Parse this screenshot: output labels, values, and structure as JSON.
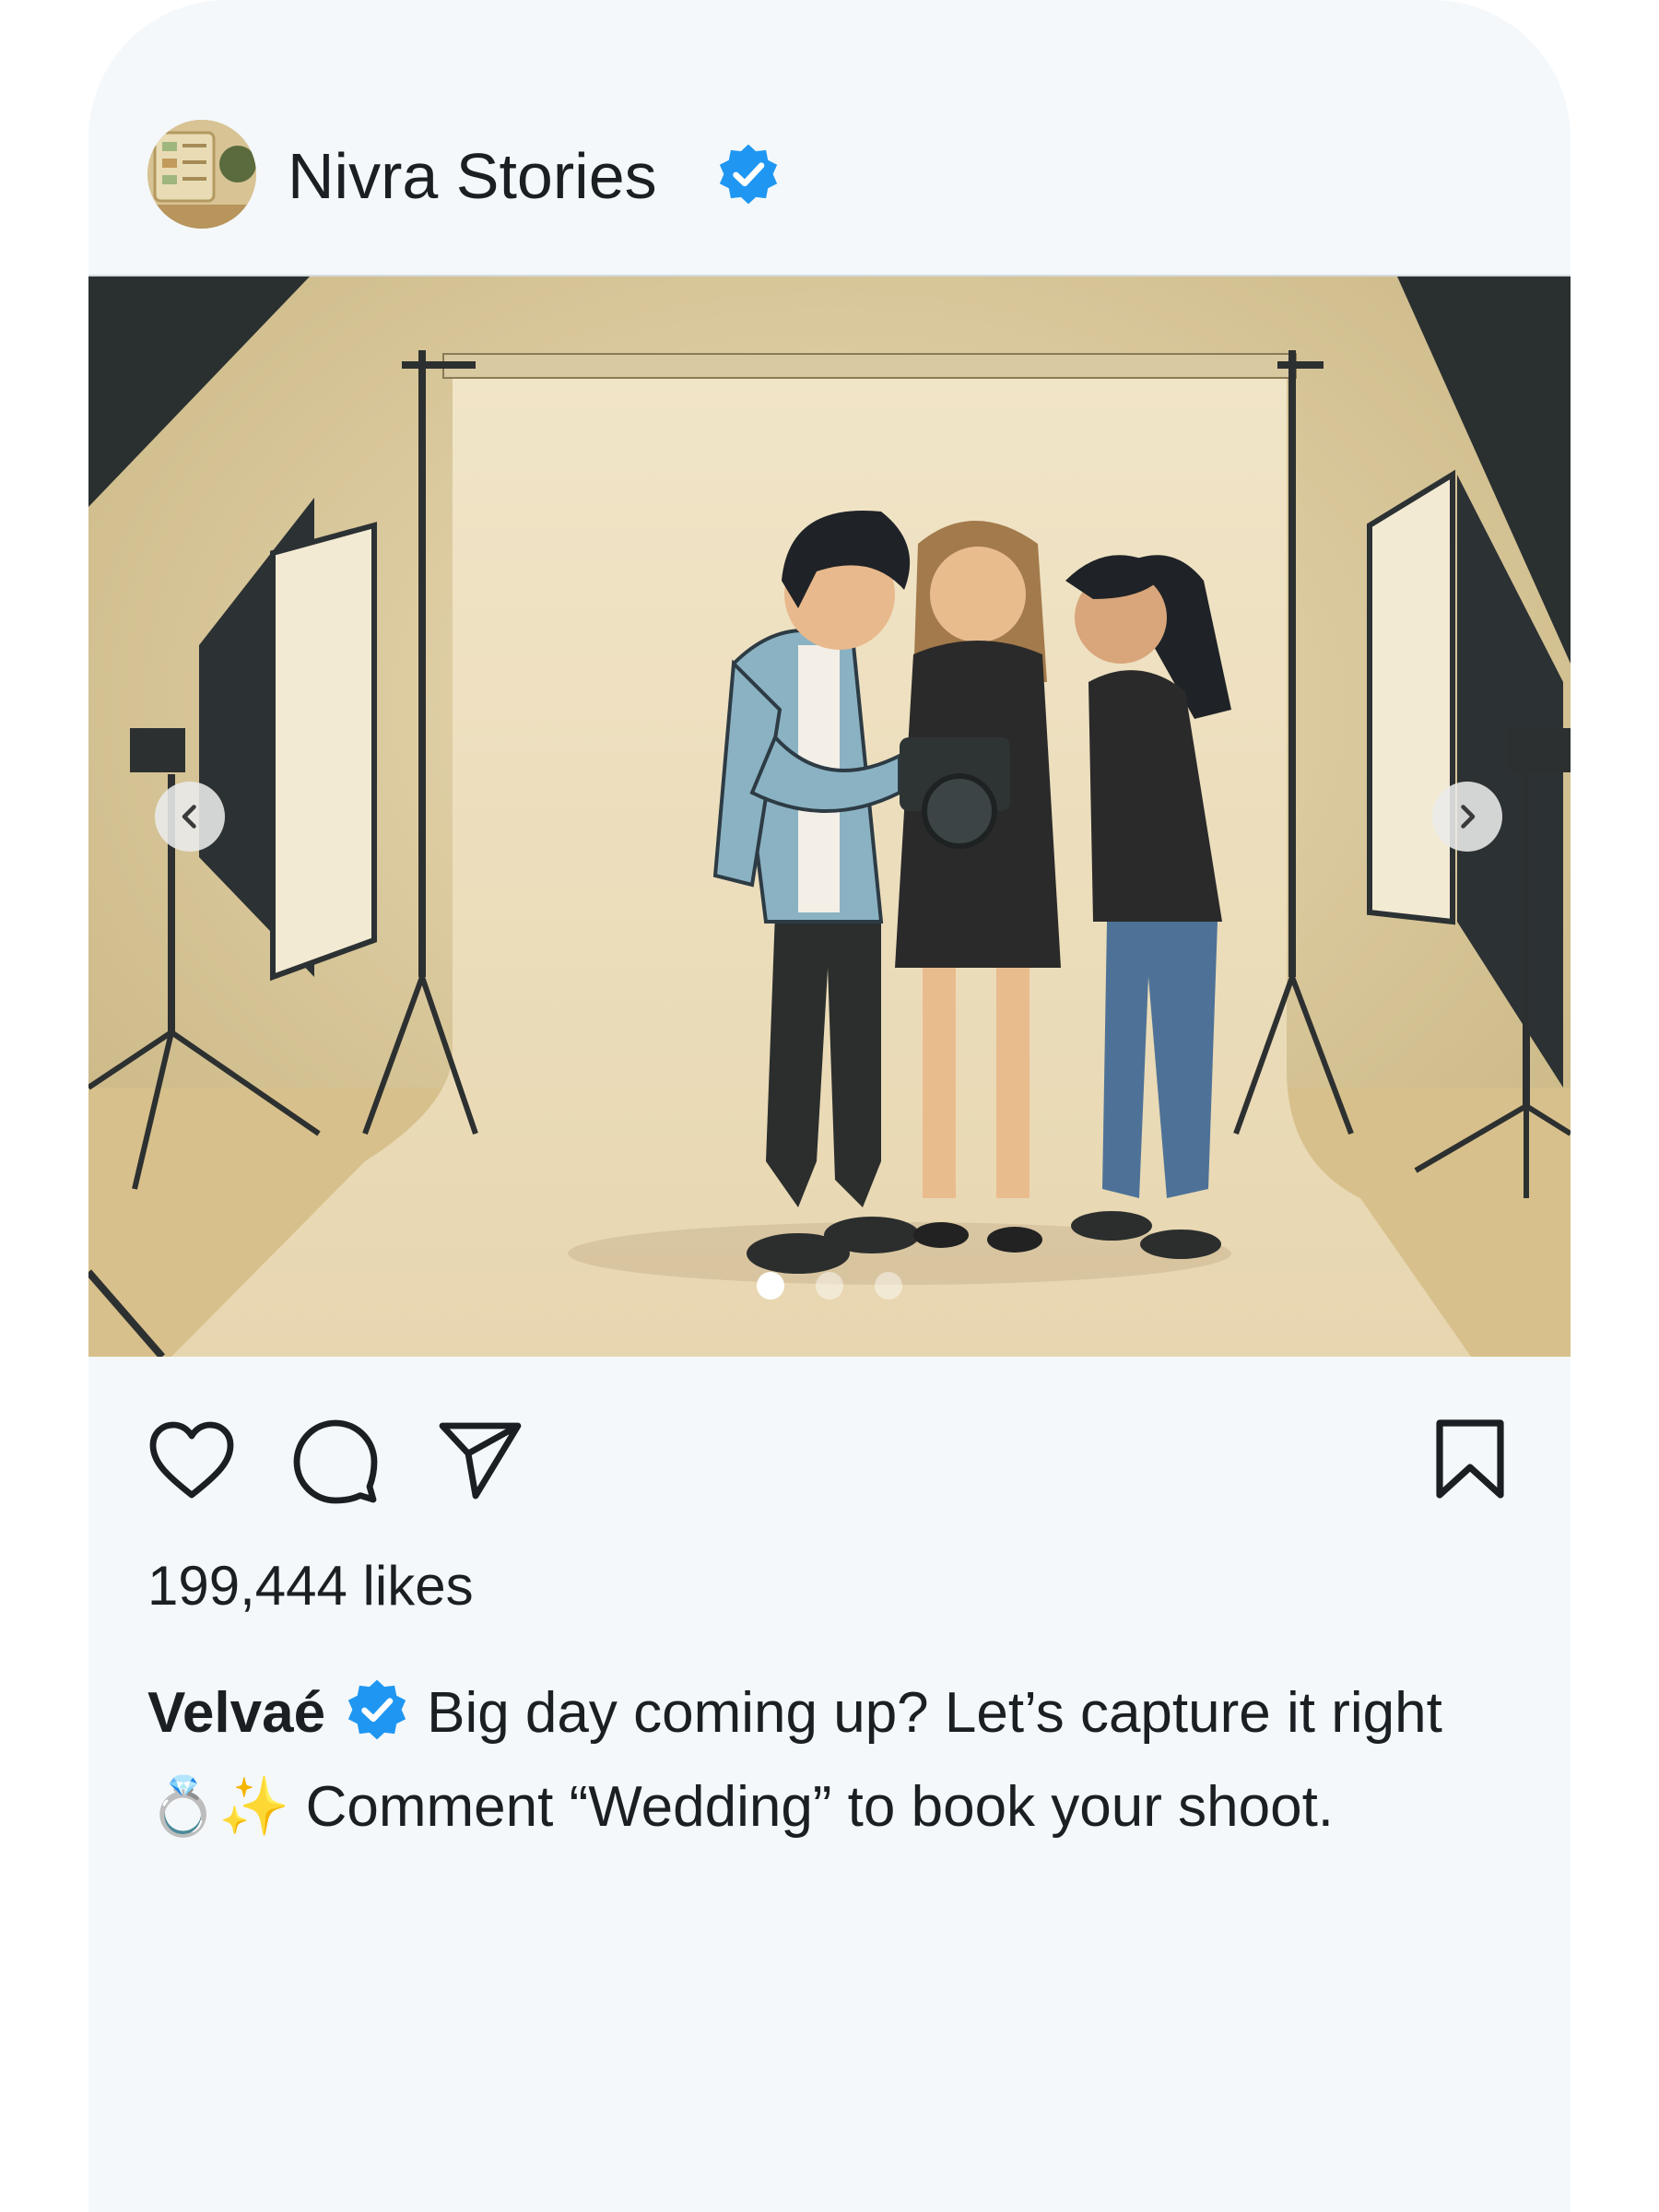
{
  "account": {
    "name": "Nivra Stories",
    "verified": true,
    "verified_icon": "verified-badge-icon",
    "badge_color": "#1f97f2"
  },
  "post": {
    "image_description_icon": "photo-studio-illustration",
    "carousel": {
      "total_slides": 3,
      "current_slide": 1
    },
    "likes_text": "199,444 likes",
    "caption": {
      "author": "Velvaé",
      "author_verified": true,
      "text": "Big day coming up? Let’s capture it right 💍✨ Comment “Wedding” to book your shoot."
    }
  },
  "actions": {
    "like_icon": "heart-icon",
    "comment_icon": "comment-icon",
    "share_icon": "send-icon",
    "save_icon": "bookmark-icon"
  },
  "colors": {
    "card_bg": "#f4f8fb",
    "text": "#1b1f23",
    "studio_wall": "#e3d3ae",
    "backdrop": "#efe4c8"
  }
}
